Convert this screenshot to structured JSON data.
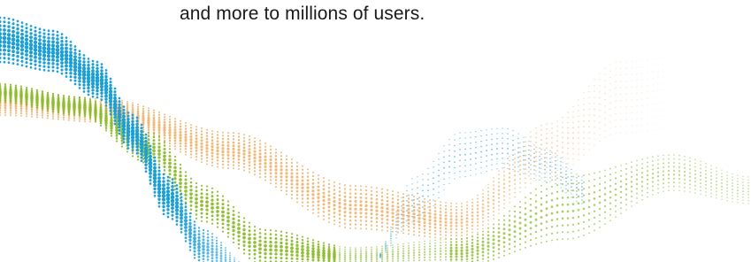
{
  "hero": {
    "tagline": "and more to millions of users."
  },
  "artwork": {
    "name": "dotted-wave-ribbons",
    "colors": {
      "blue": "#1a9fd6",
      "green": "#8dbb2a",
      "orange": "#f0b46e"
    }
  }
}
